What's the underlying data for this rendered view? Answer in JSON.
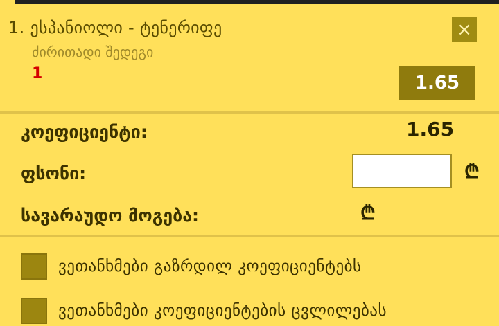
{
  "bet": {
    "number": "1.",
    "event": "ესპანიოლი - ტენერიფე",
    "market": "ძირითადი შედეგი",
    "selection": "1",
    "odd": "1.65"
  },
  "close_icon": "×",
  "summary": {
    "coef_label": "კოეფიციენტი:",
    "coef_value": "1.65",
    "stake_label": "ფსონი:",
    "stake_value": "",
    "stake_currency": "₾",
    "win_label": "სავარაუდო მოგება:",
    "win_value": "",
    "win_currency": "₾"
  },
  "options": [
    {
      "label": "ვეთანხმები გაზრდილ კოეფიციენტებს",
      "checked": false
    },
    {
      "label": "ვეთანხმები კოეფიციენტების ცვლილებას",
      "checked": false
    }
  ],
  "colors": {
    "background": "#ffe05a",
    "button": "#8f7b0d",
    "selection": "#d40000"
  }
}
